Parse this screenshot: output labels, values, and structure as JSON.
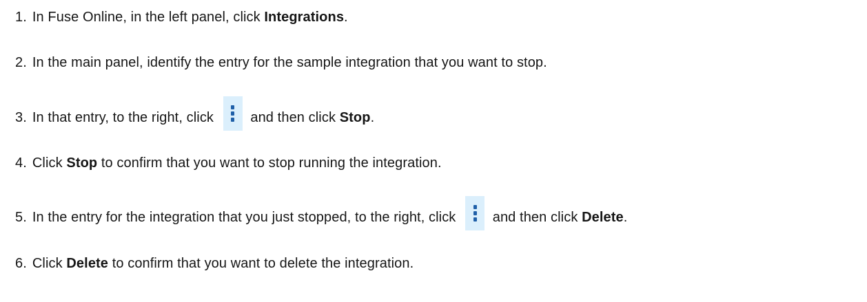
{
  "steps": [
    {
      "number": "1.",
      "before": "In Fuse Online, in the left panel, click ",
      "bold": "Integrations",
      "after": "."
    },
    {
      "number": "2.",
      "text": "In the main panel, identify the entry for the sample integration that you want to stop."
    },
    {
      "number": "3.",
      "before": "In that entry, to the right, click ",
      "icon": "kebab-menu-icon",
      "middle": " and then click ",
      "bold": "Stop",
      "after": "."
    },
    {
      "number": "4.",
      "before": "Click ",
      "bold": "Stop",
      "after": " to confirm that you want to stop running the integration."
    },
    {
      "number": "5.",
      "before": "In the entry for the integration that you just stopped, to the right, click ",
      "icon": "kebab-menu-icon",
      "middle": " and then click ",
      "bold": "Delete",
      "after": "."
    },
    {
      "number": "6.",
      "before": "Click ",
      "bold": "Delete",
      "after": " to confirm that you want to delete the integration."
    }
  ],
  "colors": {
    "text": "#151515",
    "icon_background": "#dbeffc",
    "icon_dots": "#1f5fa8"
  }
}
